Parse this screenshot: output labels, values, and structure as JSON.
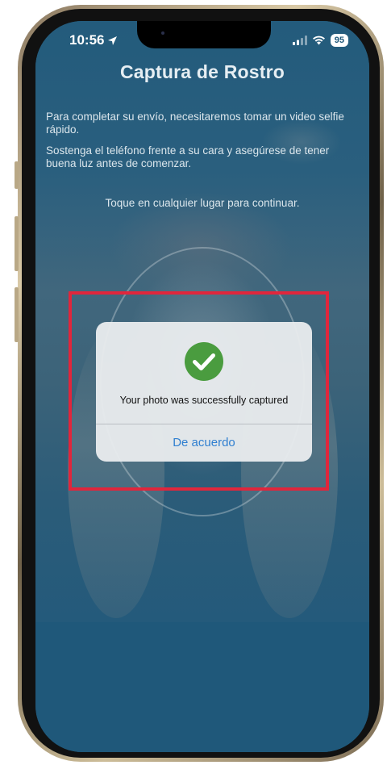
{
  "status_bar": {
    "time": "10:56",
    "battery": "95",
    "location_icon": "location-arrow-icon",
    "signal_icon": "cellular-signal-icon",
    "wifi_icon": "wifi-icon"
  },
  "screen": {
    "title": "Captura de Rostro",
    "paragraph_1": "Para completar su envío, necesitaremos tomar un video selfie rápido.",
    "paragraph_2": "Sostenga el teléfono frente a su cara y asegúrese de tener buena luz antes de comenzar.",
    "tap_hint": "Toque en cualquier lugar para continuar."
  },
  "alert": {
    "icon": "check-circle-icon",
    "message": "Your photo was successfully captured",
    "ok_label": "De acuerdo"
  },
  "colors": {
    "screen_bg": "#1f587a",
    "highlight_border": "#e0263c",
    "success_green": "#4a9c3f",
    "button_blue": "#2f7fd0"
  }
}
